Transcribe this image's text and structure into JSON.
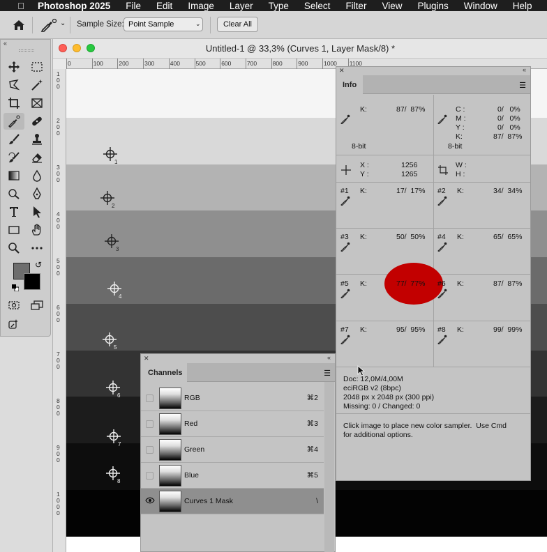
{
  "menubar": {
    "app_name": "Photoshop 2025",
    "items": [
      "File",
      "Edit",
      "Image",
      "Layer",
      "Type",
      "Select",
      "Filter",
      "View",
      "Plugins",
      "Window",
      "Help"
    ]
  },
  "options_bar": {
    "sample_size_label": "Sample Size:",
    "sample_size_value": "Point Sample",
    "clear_all_label": "Clear All"
  },
  "document": {
    "title": "Untitled-1 @ 33,3% (Curves 1, Layer Mask/8) *",
    "ruler_h": [
      "0",
      "100",
      "200",
      "300",
      "400",
      "500",
      "600",
      "700",
      "800",
      "900",
      "1000",
      "1100"
    ],
    "ruler_v": [
      "1\n0\n0",
      "2\n0\n0",
      "3\n0\n0",
      "4\n0\n0",
      "5\n0\n0",
      "6\n0\n0",
      "7\n0\n0",
      "8\n0\n0",
      "9\n0\n0",
      "1\n0\n0\n0"
    ],
    "band_colors": [
      "#f5f5f5",
      "#d9d9d9",
      "#b3b3b3",
      "#8f8f8f",
      "#6b6b6b",
      "#4d4d4d",
      "#333333",
      "#1c1c1c",
      "#0d0d0d",
      "#030303"
    ],
    "samplers": [
      "1",
      "2",
      "3",
      "4",
      "5",
      "6",
      "7",
      "8"
    ]
  },
  "info_panel": {
    "tab_label": "Info",
    "k_label": "K:",
    "primary_k": "87/  87%",
    "bit_depth_left": "8-bit",
    "c_label": "C :",
    "m_label": "M :",
    "y_label": "Y :",
    "cmyk_c": "0/   0%",
    "cmyk_m": "0/   0%",
    "cmyk_y": "0/   0%",
    "cmyk_k": "87/  87%",
    "bit_depth_right": "8-bit",
    "x_label": "X :",
    "y_coord_label": "Y :",
    "x_value": "1256",
    "y_value": "1265",
    "w_label": "W :",
    "h_label": "H :",
    "samplers": [
      {
        "id": "#1",
        "value": "17/  17%"
      },
      {
        "id": "#2",
        "value": "34/  34%"
      },
      {
        "id": "#3",
        "value": "50/  50%"
      },
      {
        "id": "#4",
        "value": "65/  65%"
      },
      {
        "id": "#5",
        "value": "77/  77%"
      },
      {
        "id": "#6",
        "value": "87/  87%"
      },
      {
        "id": "#7",
        "value": "95/  95%"
      },
      {
        "id": "#8",
        "value": "99/  99%"
      }
    ],
    "doc_line": "Doc: 12,0M/4,00M",
    "profile_line": "eciRGB v2 (8bpc)",
    "size_line": "2048 px x 2048 px (300 ppi)",
    "missing_line": "Missing: 0 / Changed: 0",
    "hint_line1": "Click image to place new color sampler.  Use Cmd",
    "hint_line2": "for additional options."
  },
  "channels_panel": {
    "tab_label": "Channels",
    "rows": [
      {
        "name": "RGB",
        "shortcut": "⌘2"
      },
      {
        "name": "Red",
        "shortcut": "⌘3"
      },
      {
        "name": "Green",
        "shortcut": "⌘4"
      },
      {
        "name": "Blue",
        "shortcut": "⌘5"
      },
      {
        "name": "Curves 1 Mask",
        "shortcut": "\\"
      }
    ]
  },
  "status_bar": {
    "zoom": "33,33%"
  }
}
